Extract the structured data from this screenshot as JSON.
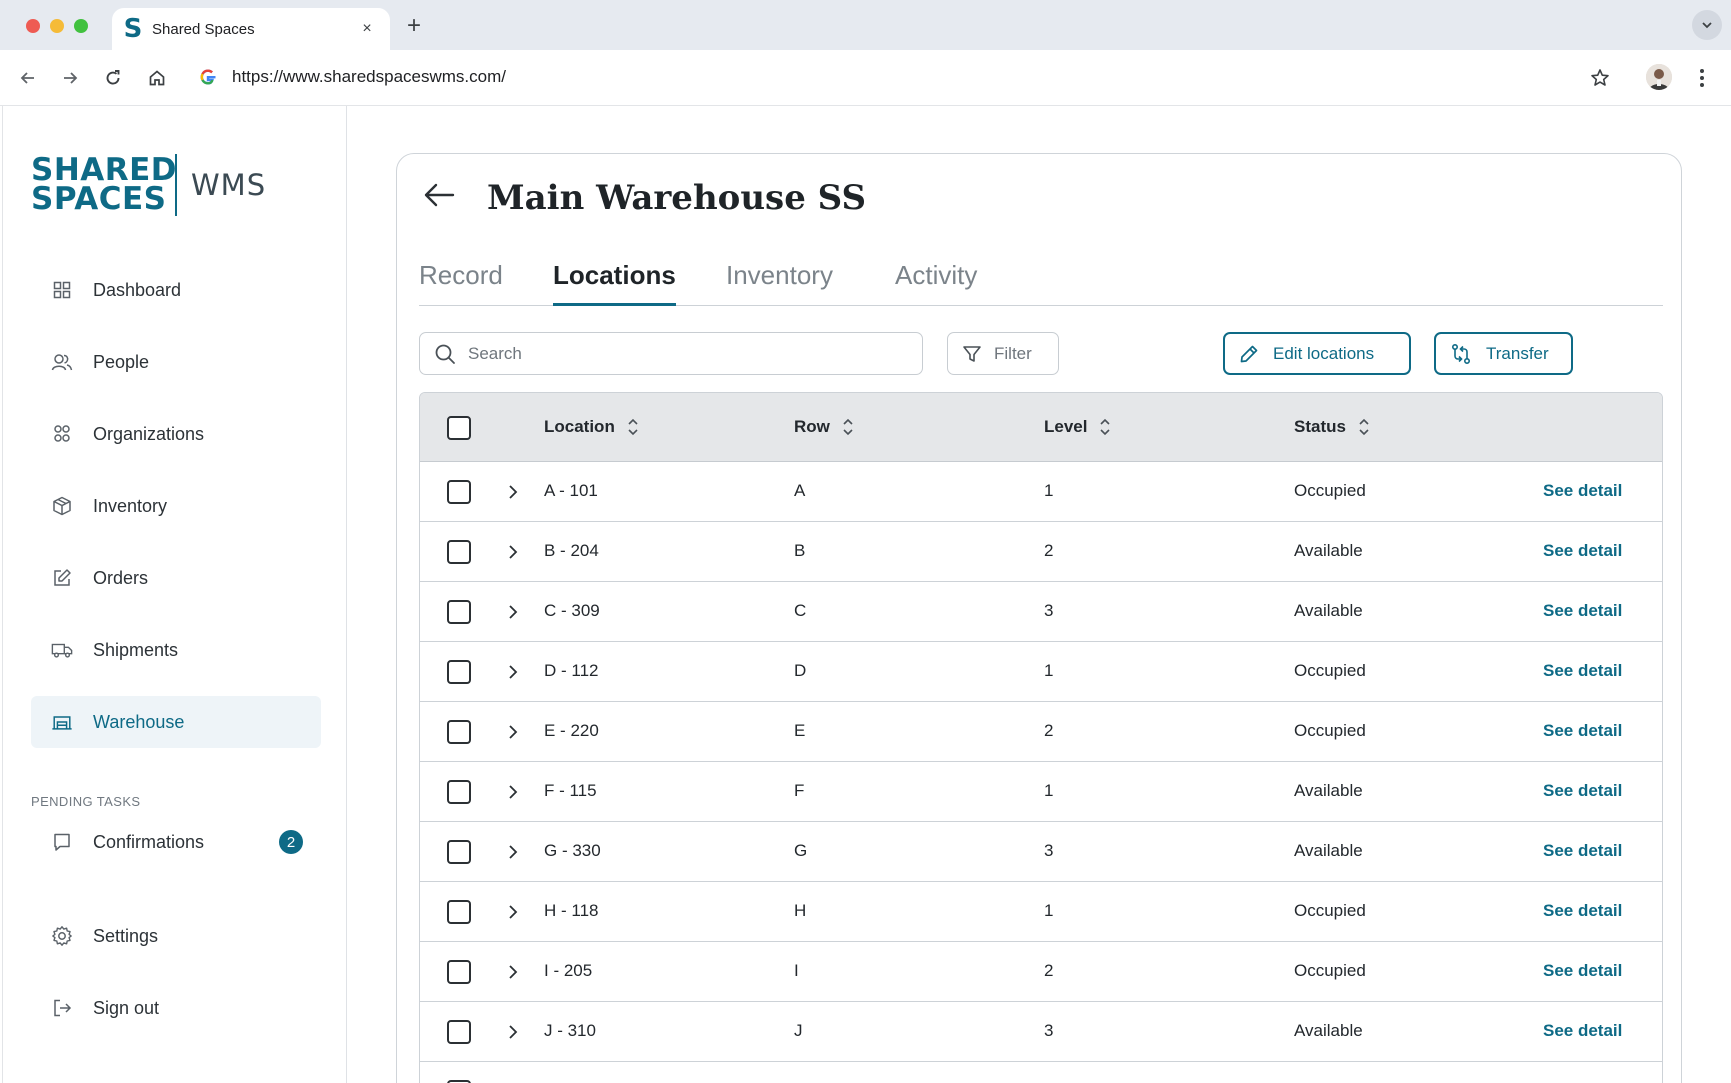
{
  "browser": {
    "tab_title": "Shared Spaces",
    "tab_favicon": "S",
    "close_glyph": "×",
    "new_tab_glyph": "+",
    "url": "https://www.sharedspaceswms.com/"
  },
  "logo": {
    "line1": "SHARED",
    "line2": "SPACES",
    "product": "WMS"
  },
  "sidebar": {
    "items": [
      {
        "label": "Dashboard",
        "icon": "grid-icon"
      },
      {
        "label": "People",
        "icon": "people-icon"
      },
      {
        "label": "Organizations",
        "icon": "organizations-icon"
      },
      {
        "label": "Inventory",
        "icon": "box-icon"
      },
      {
        "label": "Orders",
        "icon": "edit-icon"
      },
      {
        "label": "Shipments",
        "icon": "truck-icon"
      },
      {
        "label": "Warehouse",
        "icon": "warehouse-icon",
        "active": true
      }
    ],
    "pending_label": "PENDING TASKS",
    "confirmations_label": "Confirmations",
    "confirmations_count": "2",
    "settings_label": "Settings",
    "signout_label": "Sign out"
  },
  "page": {
    "title": "Main Warehouse SS",
    "tabs": [
      "Record",
      "Locations",
      "Inventory",
      "Activity"
    ],
    "active_tab": "Locations",
    "search_placeholder": "Search",
    "filter_label": "Filter",
    "edit_locations_label": "Edit locations",
    "transfer_label": "Transfer"
  },
  "table": {
    "columns": [
      "Location",
      "Row",
      "Level",
      "Status"
    ],
    "action_label": "See detail",
    "rows": [
      {
        "location": "A - 101",
        "row": "A",
        "level": "1",
        "status": "Occupied"
      },
      {
        "location": "B - 204",
        "row": "B",
        "level": "2",
        "status": "Available"
      },
      {
        "location": "C - 309",
        "row": "C",
        "level": "3",
        "status": "Available"
      },
      {
        "location": "D - 112",
        "row": "D",
        "level": "1",
        "status": "Occupied"
      },
      {
        "location": "E - 220",
        "row": "E",
        "level": "2",
        "status": "Occupied"
      },
      {
        "location": "F - 115",
        "row": "F",
        "level": "1",
        "status": "Available"
      },
      {
        "location": "G - 330",
        "row": "G",
        "level": "3",
        "status": "Available"
      },
      {
        "location": "H - 118",
        "row": "H",
        "level": "1",
        "status": "Occupied"
      },
      {
        "location": "I - 205",
        "row": "I",
        "level": "2",
        "status": "Occupied"
      },
      {
        "location": "J - 310",
        "row": "J",
        "level": "3",
        "status": "Available"
      }
    ]
  },
  "colors": {
    "brand": "#0e6a86",
    "active_nav_bg": "#eef4f8",
    "header_bg": "#e5e7e9"
  }
}
